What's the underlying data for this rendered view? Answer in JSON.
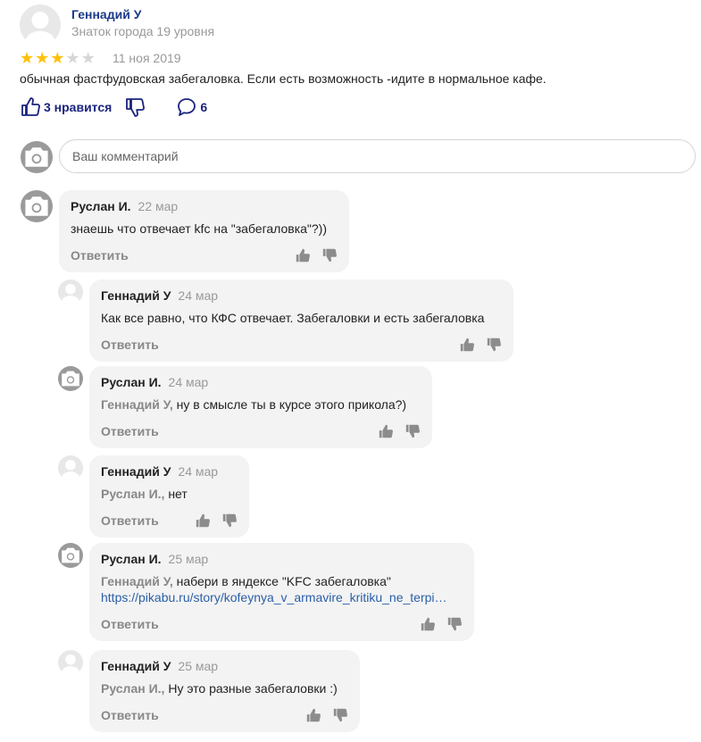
{
  "review": {
    "author": "Геннадий У",
    "level": "Знаток города 19 уровня",
    "rating": 3,
    "rating_max": 5,
    "date": "11 ноя 2019",
    "text": "обычная фастфудовская забегаловка. Если есть возможность -идите в нормальное кафе.",
    "likes_label": "3 нравится",
    "comments_count": "6"
  },
  "comment_box": {
    "placeholder": "Ваш комментарий"
  },
  "reply_label": "Ответить",
  "comments": [
    {
      "author": "Руслан И.",
      "date": "22 мар",
      "mention": "",
      "text": "знаешь что отвечает kfc на \"забегаловка\"?))",
      "link": ""
    },
    {
      "author": "Геннадий У",
      "date": "24 мар",
      "mention": "",
      "text": "Как все равно, что КФС отвечает. Забегаловки и есть забегаловка",
      "link": ""
    },
    {
      "author": "Руслан И.",
      "date": "24 мар",
      "mention": "Геннадий У,",
      "text": "ну в смысле ты в курсе этого прикола?)",
      "link": ""
    },
    {
      "author": "Геннадий У",
      "date": "24 мар",
      "mention": "Руслан И.,",
      "text": "нет",
      "link": ""
    },
    {
      "author": "Руслан И.",
      "date": "25 мар",
      "mention": "Геннадий У,",
      "text": "набери в яндексе \"KFC забегаловка\"",
      "link": "https://pikabu.ru/story/kofeynya_v_armavire_kritiku_ne_terpi…"
    },
    {
      "author": "Геннадий У",
      "date": "25 мар",
      "mention": "Руслан И.,",
      "text": "Ну это разные забегаловки :)",
      "link": ""
    }
  ],
  "colors": {
    "star_on": "#ffc107",
    "star_off": "#d6d6d6",
    "link": "#2a5fa8",
    "action": "#1a237e",
    "bubble": "#f3f3f3"
  }
}
